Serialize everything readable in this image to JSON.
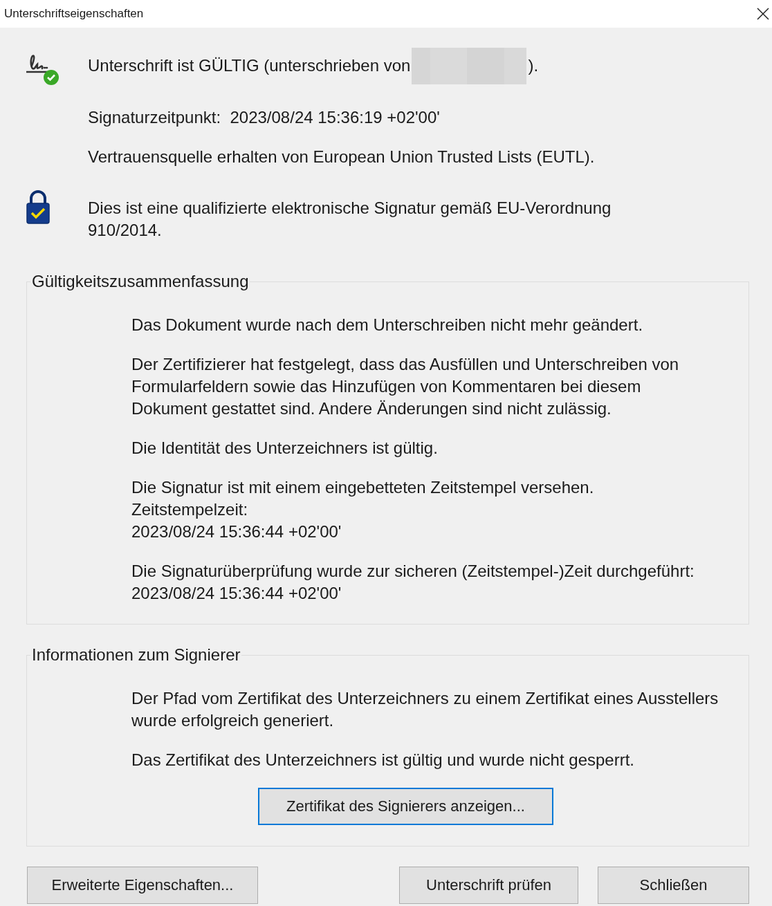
{
  "window": {
    "title": "Unterschriftseigenschaften"
  },
  "status": {
    "valid_prefix": "Unterschrift ist GÜLTIG (unterschrieben von",
    "valid_suffix": ").",
    "lines": [
      "Signaturzeitpunkt:  2023/08/24 15:36:19 +02'00'",
      "Vertrauensquelle erhalten von European Union Trusted Lists (EUTL)."
    ]
  },
  "qualified": "Dies ist eine qualifizierte elektronische Signatur gemäß EU-Verordnung 910/2014.",
  "groups": [
    {
      "title": "Gültigkeitszusammenfassung",
      "paragraphs": [
        "Das Dokument wurde nach dem Unterschreiben nicht mehr geändert.",
        "Der Zertifizierer hat festgelegt, dass das Ausfüllen und Unterschreiben von Formularfeldern sowie das Hinzufügen von Kommentaren bei diesem Dokument gestattet sind. Andere Änderungen sind nicht zulässig.",
        "Die Identität des Unterzeichners ist gültig.",
        "Die Signatur ist mit einem eingebetteten Zeitstempel versehen.\nZeitstempelzeit:\n2023/08/24 15:36:44 +02'00'",
        "Die Signaturüberprüfung wurde zur sicheren (Zeitstempel-)Zeit durchgeführt:\n2023/08/24 15:36:44 +02'00'"
      ]
    },
    {
      "title": "Informationen zum Signierer",
      "paragraphs": [
        "Der Pfad vom Zertifikat des Unterzeichners zu einem Zertifikat eines Ausstellers wurde erfolgreich generiert.",
        "Das Zertifikat des Unterzeichners ist gültig und wurde nicht gesperrt."
      ],
      "button": {
        "label": "Zertifikat des Signierers anzeigen...",
        "focused": true
      }
    }
  ],
  "buttons": [
    {
      "label": "Erweiterte Eigenschaften...",
      "focused": false
    },
    {
      "label": "Unterschrift prüfen",
      "focused": false
    },
    {
      "label": "Schließen",
      "focused": false
    }
  ]
}
